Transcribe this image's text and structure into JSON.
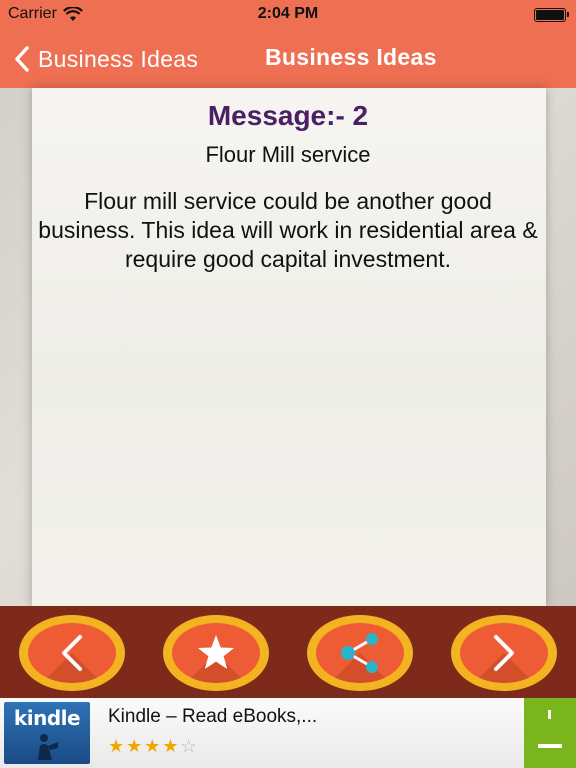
{
  "status_bar": {
    "carrier": "Carrier",
    "time": "2:04 PM"
  },
  "nav": {
    "back_label": "Business Ideas",
    "title": "Business Ideas"
  },
  "message": {
    "title": "Message:- 2",
    "subtitle": "Flour Mill service",
    "body": "Flour mill service could be another good business. This idea will work in residential area & require good capital investment."
  },
  "toolbar": {
    "buttons": [
      {
        "icon": "chevron-left-icon"
      },
      {
        "icon": "star-icon"
      },
      {
        "icon": "share-icon"
      },
      {
        "icon": "chevron-right-icon"
      }
    ]
  },
  "ad": {
    "app_icon_text": "kindle",
    "title": "Kindle – Read eBooks,...",
    "stars_on": "★★★★",
    "stars_off": "☆",
    "rating_stars": 3.5
  },
  "colors": {
    "accent": "#ee6f51",
    "toolbar": "#7d2a1b",
    "title_purple": "#4b1f63",
    "button_ring": "#f3b421",
    "install_green": "#7ab51d"
  }
}
